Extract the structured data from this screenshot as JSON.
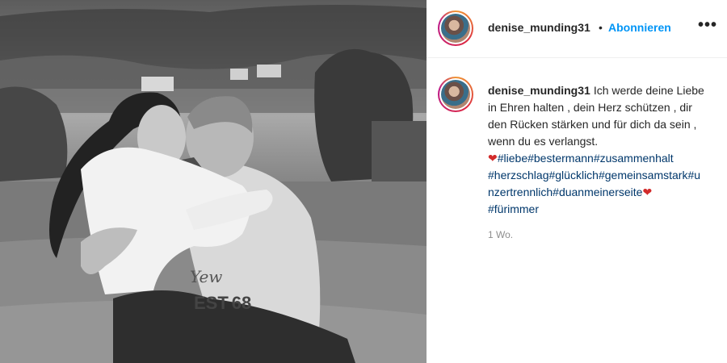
{
  "post": {
    "username": "denise_munding31",
    "separator": "•",
    "follow_label": "Abonnieren",
    "more_label": "•••",
    "caption_text": "Ich werde deine Liebe in Ehren halten , dein Herz schützen , dir den Rücken stärken und für dich da sein , wenn du es verlangst.",
    "heart_emoji": "❤",
    "hashtags_line1": "#liebe#bestermann#zusammenhalt",
    "hashtags_line2": "#herzschlag#glücklich#gemeinsamstark#unzertrennlich#duanmeinerseite",
    "hashtags_line3": "#fürimmer",
    "timestamp": "1 Wo.",
    "shirt_number": "68",
    "shirt_text": "EST"
  },
  "colors": {
    "accent": "#0095f6",
    "hashtag": "#00376b",
    "heart": "#d22b2b",
    "muted": "#8e8e8e"
  },
  "icons": {
    "more": "more-options-icon",
    "avatar": "profile-avatar"
  }
}
